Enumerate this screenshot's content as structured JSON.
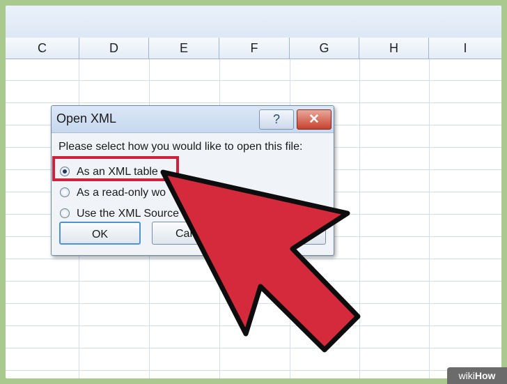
{
  "spreadsheet": {
    "columns": [
      "C",
      "D",
      "E",
      "F",
      "G",
      "H",
      "I"
    ]
  },
  "dialog": {
    "title": "Open XML",
    "help_label": "?",
    "close_label": "✕",
    "prompt": "Please select how you would like to open this file:",
    "options": [
      {
        "label": "As an XML table",
        "selected": true
      },
      {
        "label": "As a read-only wo",
        "selected": false
      },
      {
        "label": "Use the XML Source",
        "selected": false
      }
    ],
    "ok_label": "OK",
    "cancel_label": "Can"
  },
  "annotation": {
    "highlight_color": "#d0213a",
    "arrow_color": "#d42a3c"
  },
  "watermark": {
    "prefix": "wiki",
    "suffix": "How"
  }
}
